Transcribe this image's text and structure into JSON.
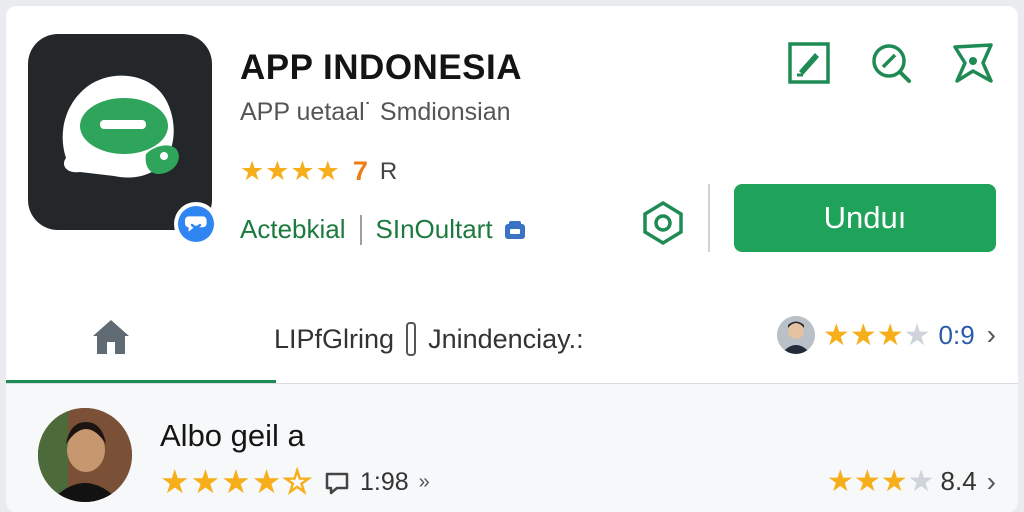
{
  "app": {
    "title": "APP INDONESIA",
    "subtitle": "APP uetaal˙ Smdionsian",
    "stars_text": "★★★★",
    "rating_value": "7",
    "rating_suffix": "R",
    "developer": "Actebkial",
    "category": "SInOultart",
    "install_label": "Unduı"
  },
  "tabs": {
    "label": "LIPfGlring",
    "label2": "Jnindenciay.:",
    "rating_value": "0:9",
    "chevron": "›"
  },
  "review": {
    "name": "Albo ɡeil a",
    "comment_count": "1:98",
    "comment_arrow": "»",
    "score": "8.4",
    "chevron": "›"
  },
  "colors": {
    "accent": "#1fa35b",
    "star": "#f6ae1a",
    "text_green": "#1d7a3e"
  },
  "icons": [
    "edit-icon",
    "search-icon",
    "bookmark-icon",
    "shield-icon",
    "home-icon",
    "chat-bubble-icon",
    "comment-icon"
  ]
}
